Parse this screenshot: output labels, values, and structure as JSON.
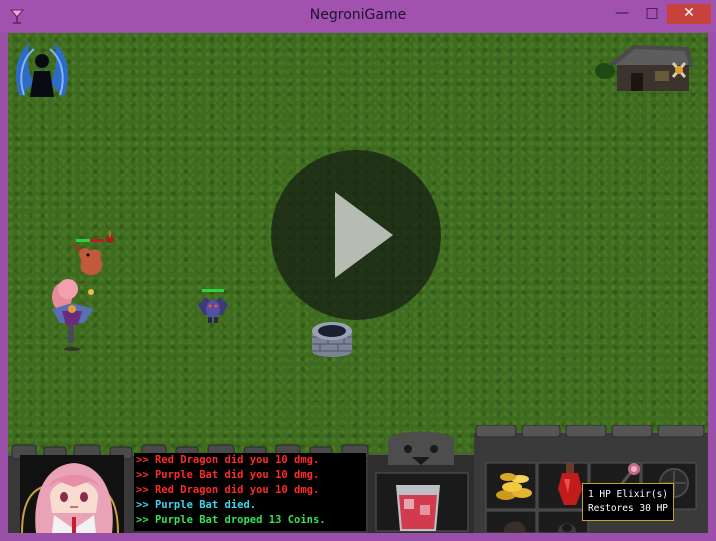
{
  "window": {
    "title": "NegroniGame",
    "minimize_glyph": "—",
    "maximize_glyph": "□",
    "close_glyph": "✕"
  },
  "icons": [
    "negroni-app-icon",
    "guild-emblem-icon",
    "play-icon",
    "gold-coins-icon",
    "hp-elixir-icon",
    "staff-icon",
    "shield-slot-icon",
    "helmet-slot-icon",
    "hooded-slot-icon"
  ],
  "chat": {
    "lines": [
      {
        "text": ">> Red Dragon did you 10 dmg.",
        "color": "#ff2a2a"
      },
      {
        "text": ">> Purple Bat did you 10 dmg.",
        "color": "#ff2a2a"
      },
      {
        "text": ">> Red Dragon did you 10 dmg.",
        "color": "#ff2a2a"
      },
      {
        "text": ">> Purple Bat died.",
        "color": "#3fd7ee"
      },
      {
        "text": ">> Purple Bat droped 13 Coins.",
        "color": "#35e25a"
      }
    ]
  },
  "tooltip": {
    "line1": "1 HP Elixir(s)",
    "line2": "Restores 30 HP"
  },
  "colors": {
    "grass": "#3e6b1f",
    "frame": "#a052ae",
    "hud_stone": "#3a3a3a",
    "tooltip_border": "#c9a227"
  }
}
